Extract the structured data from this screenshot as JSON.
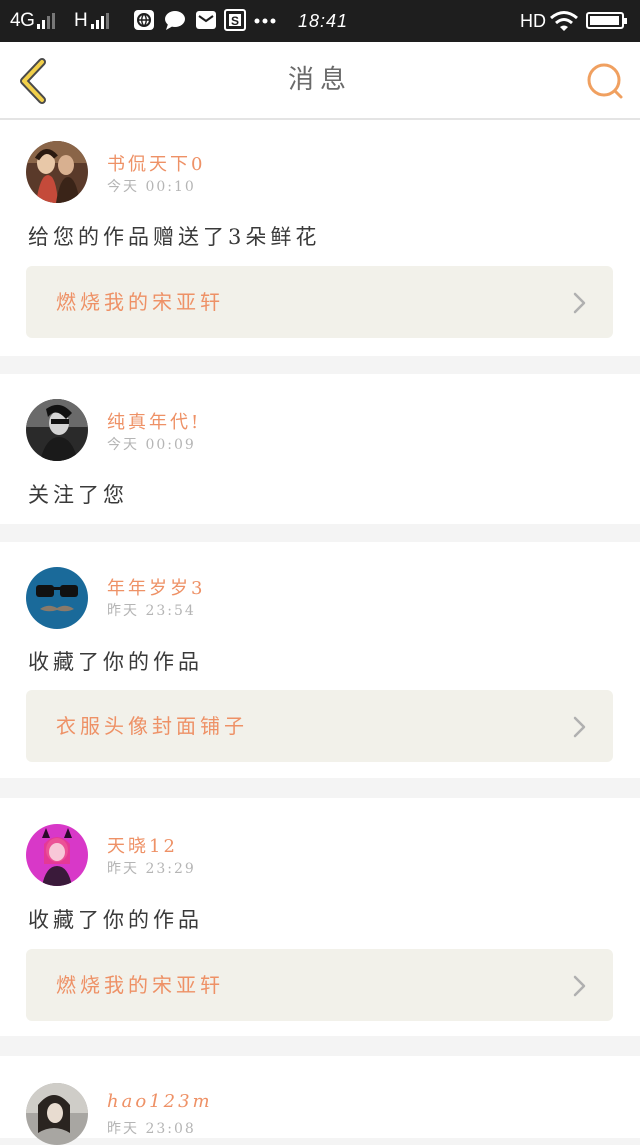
{
  "status_bar": {
    "network": "4G",
    "network2": "H",
    "time": "18:41",
    "hd": "HD",
    "icons": [
      "browser-icon",
      "chat-icon",
      "mail-icon",
      "s-app-icon",
      "more-dots-icon"
    ],
    "battery_level": 0.95
  },
  "header": {
    "title": "消息",
    "back_icon": "chevron-left-icon",
    "search_icon": "search-icon",
    "accent_color": "#f0a060"
  },
  "colors": {
    "username": "#ee9166",
    "timestamp": "#b5b5b5",
    "action_text": "#3a3a3a",
    "link_bg": "#f2f1ea",
    "divider_bg": "#f4f4f4"
  },
  "messages": [
    {
      "username": "书侃天下0",
      "time": "今天  00:10",
      "action": "给您的作品赠送了3朵鲜花",
      "work": "燃烧我的宋亚轩"
    },
    {
      "username": "纯真年代!",
      "time": "今天  00:09",
      "action": "关注了您",
      "work": null
    },
    {
      "username": "年年岁岁3",
      "time": "昨天  23:54",
      "action": "收藏了你的作品",
      "work": "衣服头像封面铺子"
    },
    {
      "username": "天晓12",
      "time": "昨天  23:29",
      "action": "收藏了你的作品",
      "work": "燃烧我的宋亚轩"
    },
    {
      "username": "hao123m",
      "time": "昨天  23:08",
      "action": "",
      "work": null
    }
  ]
}
